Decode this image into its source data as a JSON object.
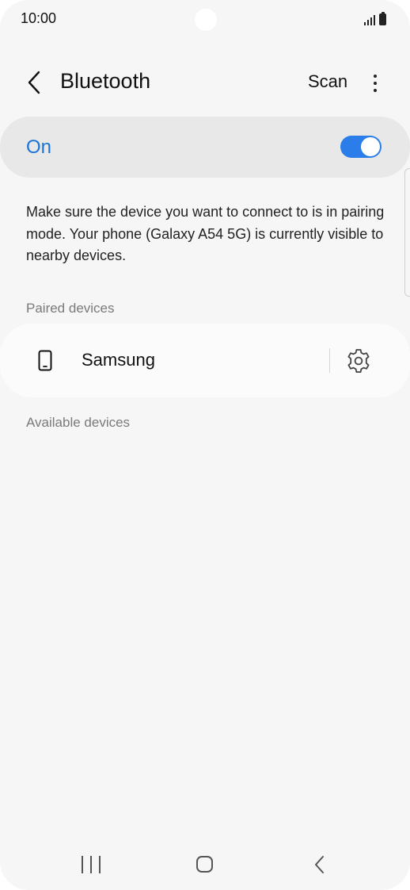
{
  "status_bar": {
    "time": "10:00"
  },
  "header": {
    "title": "Bluetooth",
    "scan_label": "Scan"
  },
  "bluetooth_switch": {
    "label": "On",
    "enabled": true
  },
  "description": "Make sure the device you want to connect to is in pairing mode. Your phone (Galaxy A54 5G) is currently visible to nearby devices.",
  "paired_devices": {
    "header": "Paired devices",
    "items": [
      {
        "name": "Samsung",
        "icon": "phone-icon",
        "settings_icon": "gear-icon"
      }
    ]
  },
  "available_devices": {
    "header": "Available devices",
    "items": []
  },
  "colors": {
    "accent": "#2b7de9",
    "switch_label": "#1a73d6",
    "background": "#f6f6f6",
    "switch_card": "#e8e8e8"
  }
}
